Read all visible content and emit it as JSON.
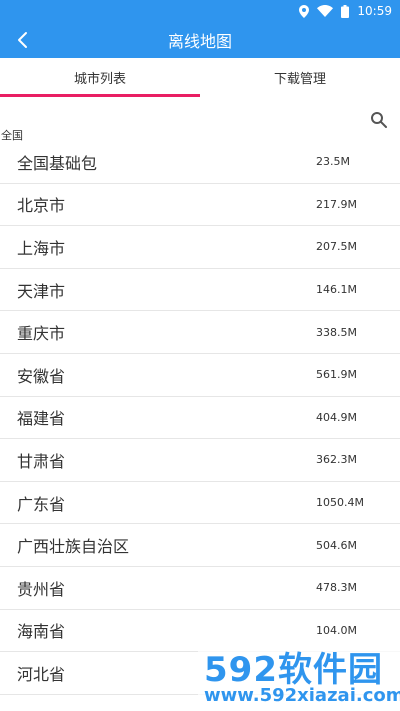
{
  "status": {
    "time": "10:59"
  },
  "header": {
    "title": "离线地图"
  },
  "tabs": [
    {
      "label": "城市列表"
    },
    {
      "label": "下载管理"
    }
  ],
  "list": {
    "section_label": "全国",
    "rows": [
      {
        "name": "全国基础包",
        "size": "23.5M"
      },
      {
        "name": "北京市",
        "size": "217.9M"
      },
      {
        "name": "上海市",
        "size": "207.5M"
      },
      {
        "name": "天津市",
        "size": "146.1M"
      },
      {
        "name": "重庆市",
        "size": "338.5M"
      },
      {
        "name": "安徽省",
        "size": "561.9M"
      },
      {
        "name": "福建省",
        "size": "404.9M"
      },
      {
        "name": "甘肃省",
        "size": "362.3M"
      },
      {
        "name": "广东省",
        "size": "1050.4M"
      },
      {
        "name": "广西壮族自治区",
        "size": "504.6M"
      },
      {
        "name": "贵州省",
        "size": "478.3M"
      },
      {
        "name": "海南省",
        "size": "104.0M"
      },
      {
        "name": "河北省",
        "size": ""
      }
    ]
  },
  "watermark": {
    "top": "592软件园",
    "bottom": "www.592xiazai.com"
  },
  "colors": {
    "primary": "#2f95ee",
    "tab_indicator": "#e91e63"
  }
}
